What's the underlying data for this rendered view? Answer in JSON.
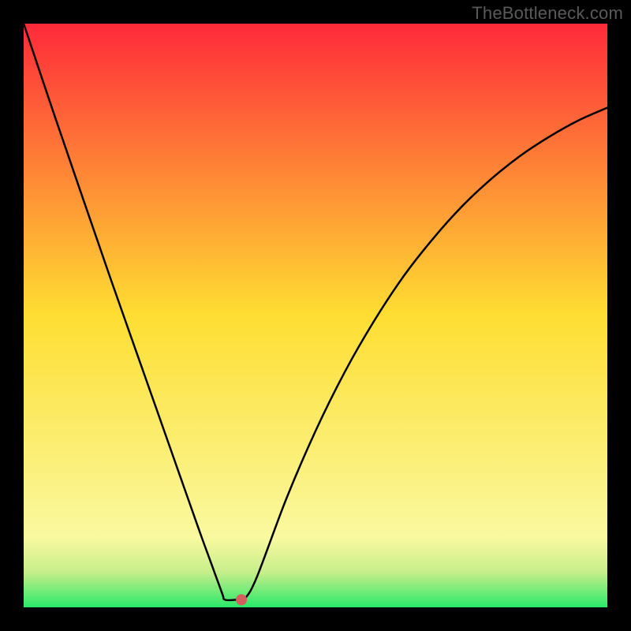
{
  "watermark": "TheBottleneck.com",
  "chart_data": {
    "type": "line",
    "title": "",
    "xlabel": "",
    "ylabel": "",
    "xlim": [
      0,
      100
    ],
    "ylim": [
      0,
      100
    ],
    "grid": false,
    "series": [
      {
        "name": "curve",
        "x": [
          0,
          5,
          10,
          15,
          20,
          25,
          30,
          32,
          34,
          34.5,
          36.5,
          37,
          38,
          40,
          45,
          50,
          55,
          60,
          65,
          70,
          75,
          80,
          85,
          90,
          95,
          100
        ],
        "y": [
          100,
          85.1,
          70.5,
          56.0,
          41.8,
          27.6,
          13.4,
          7.9,
          2.4,
          1.3,
          1.3,
          1.3,
          1.6,
          5.3,
          18.6,
          30.2,
          40.3,
          49.0,
          56.6,
          63.0,
          68.6,
          73.3,
          77.3,
          80.6,
          83.4,
          85.6
        ]
      }
    ],
    "marker": {
      "x": 37.3,
      "y": 1.3,
      "color": "#d1605e",
      "radius_px": 7
    },
    "background_gradient": {
      "stops": [
        {
          "offset": 0,
          "color": "#fe2a3a"
        },
        {
          "offset": 50,
          "color": "#fede32"
        },
        {
          "offset": 88,
          "color": "#faf9a0"
        },
        {
          "offset": 94,
          "color": "#c6ee8a"
        },
        {
          "offset": 100,
          "color": "#2ae969"
        }
      ]
    }
  }
}
